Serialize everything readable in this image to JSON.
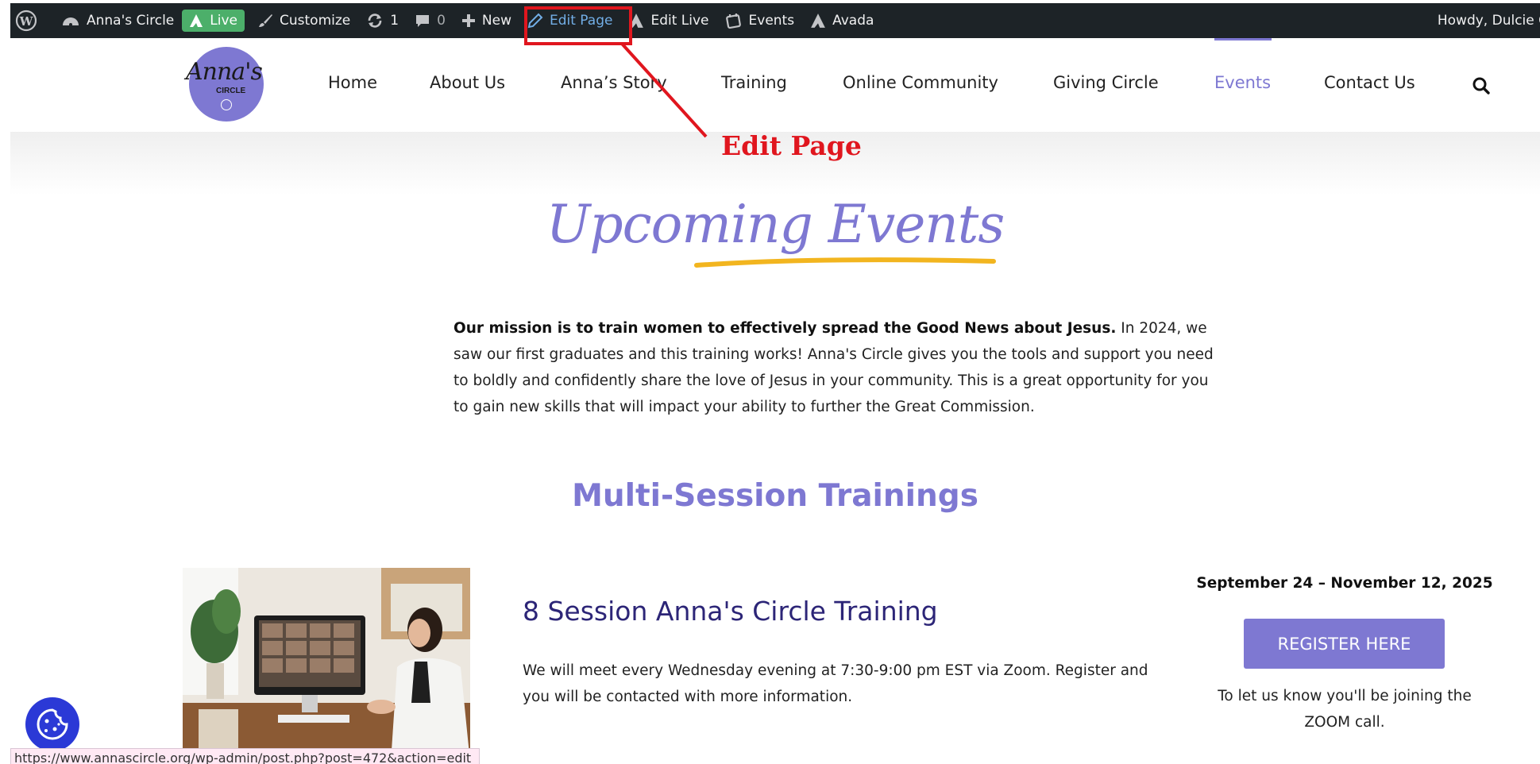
{
  "adminbar": {
    "site_name": "Anna's Circle",
    "live_label": "Live",
    "customize_label": "Customize",
    "updates_count": "1",
    "comments_count": "0",
    "new_label": "New",
    "edit_page_label": "Edit Page",
    "edit_live_label": "Edit Live",
    "events_label": "Events",
    "avada_label": "Avada",
    "howdy": "Howdy, Dulcie C"
  },
  "annotation": {
    "callout_text": "Edit Page",
    "color": "#e0161e"
  },
  "header": {
    "logo_text": "Anna's",
    "logo_subtext": "CIRCLE",
    "nav": [
      {
        "label": "Home"
      },
      {
        "label": "About Us"
      },
      {
        "label": "Anna’s Story"
      },
      {
        "label": "Training"
      },
      {
        "label": "Online Community"
      },
      {
        "label": "Giving Circle"
      },
      {
        "label": "Events",
        "active": true
      },
      {
        "label": "Contact Us"
      }
    ],
    "accent_color": "#7e78d2"
  },
  "main": {
    "script_title": "Upcoming Events",
    "mission_bold": "Our mission is to train women to effectively spread the Good News about Jesus.",
    "mission_rest": " In 2024, we saw our first graduates and this training works! Anna's Circle gives you the tools and support you need to boldly and confidently share the love of Jesus in your community. This is a great opportunity for you to gain new skills that will impact your ability to further the Great Commission.",
    "section_title": "Multi-Session Trainings"
  },
  "event": {
    "title": "8 Session Anna's Circle Training",
    "description": "We will meet every Wednesday evening at 7:30-9:00 pm EST via Zoom. Register and you will be contacted with more information.",
    "date": "September 24 – November 12, 2025",
    "register_label": "REGISTER HERE",
    "note": "To let us know you'll be joining the ZOOM call."
  },
  "statusbar": {
    "url": "https://www.annascircle.org/wp-admin/post.php?post=472&action=edit"
  }
}
